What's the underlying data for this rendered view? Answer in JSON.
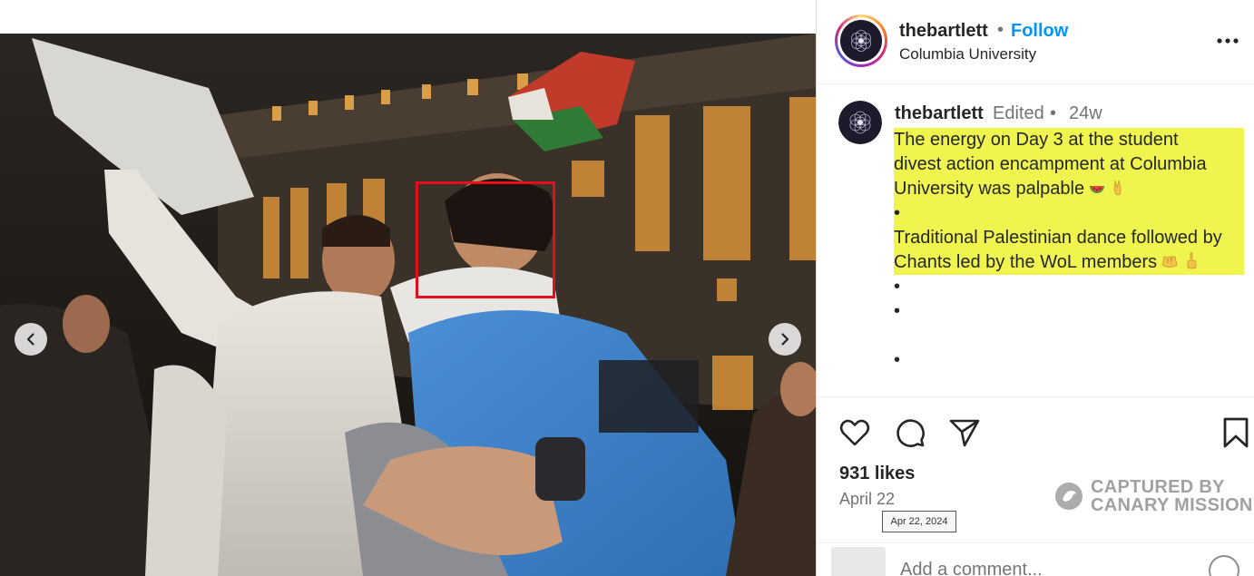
{
  "post": {
    "username": "thebartlett",
    "separator": "•",
    "follow_label": "Follow",
    "location": "Columbia University",
    "more_icon": "more-horizontal-icon"
  },
  "caption": {
    "username": "thebartlett",
    "edited": "Edited",
    "dot": "•",
    "time": "24w",
    "lines": [
      "The energy on Day 3 at the student",
      "divest action encampment at Columbia",
      "University was palpable",
      "•",
      "Traditional Palestinian dance followed by",
      "Chants led by the WoL members",
      "•",
      "•",
      "",
      "•"
    ],
    "highlight_color": "#eff54e"
  },
  "media": {
    "dots_total": 10,
    "active_dot": 4,
    "prev_icon": "chevron-left-icon",
    "next_icon": "chevron-right-icon",
    "highlight_box_color": "#e3101c"
  },
  "actions": {
    "like_icon": "heart-icon",
    "comment_icon": "comment-icon",
    "share_icon": "send-icon",
    "save_icon": "bookmark-icon"
  },
  "likes": "931 likes",
  "date": "April 22",
  "date_tooltip": "Apr 22, 2024",
  "watermark": {
    "line1": "CAPTURED BY",
    "line2": "CANARY MISSION"
  },
  "comment": {
    "placeholder": "Add a comment..."
  },
  "colors": {
    "accent": "#0095f6",
    "text": "#262626",
    "muted": "#737373"
  }
}
